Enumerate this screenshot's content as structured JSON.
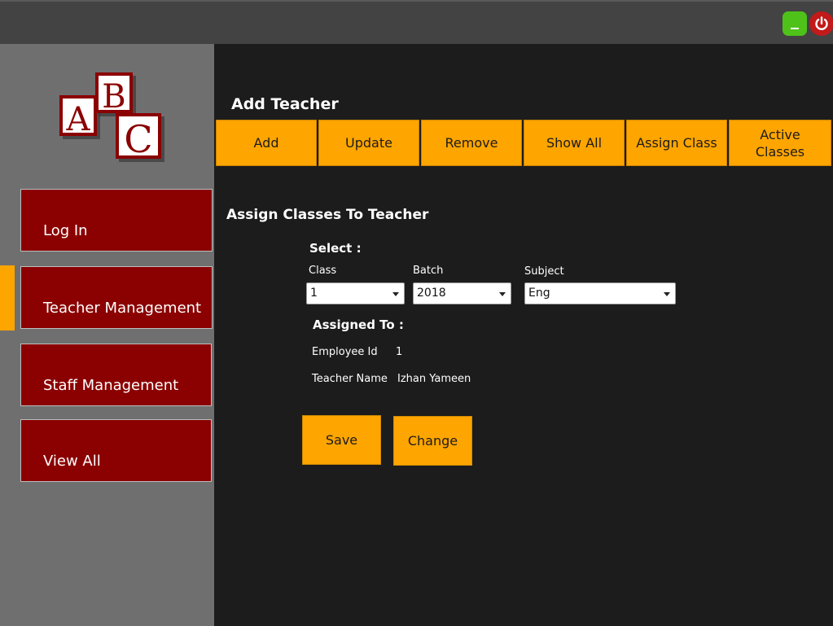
{
  "window": {
    "minimize_icon": "minimize-icon",
    "power_icon": "power-icon",
    "colors": {
      "minimize": "#4fc21a",
      "power": "#c21a1a",
      "titlebar": "#434343"
    }
  },
  "logo": {
    "letters": [
      "A",
      "B",
      "C"
    ]
  },
  "sidebar": {
    "items": [
      {
        "label": "Log In"
      },
      {
        "label": "Teacher Management"
      },
      {
        "label": "Staff Management"
      },
      {
        "label": "View All"
      }
    ],
    "active_index": 1,
    "colors": {
      "item_bg": "#8b0000",
      "marker": "#ffa500",
      "bg": "#6f6f6f"
    }
  },
  "header": {
    "title": "Add Teacher"
  },
  "tabs": [
    {
      "label": "Add"
    },
    {
      "label": "Update"
    },
    {
      "label": "Remove"
    },
    {
      "label": "Show All"
    },
    {
      "label": "Assign Class"
    },
    {
      "label": "Active Classes"
    }
  ],
  "form": {
    "title": "Assign Classes To Teacher",
    "select_heading": "Select :",
    "class": {
      "label": "Class",
      "value": "1"
    },
    "batch": {
      "label": "Batch",
      "value": "2018"
    },
    "subject": {
      "label": "Subject",
      "value": "Eng"
    },
    "assigned_heading": "Assigned To :",
    "employee_id": {
      "label": "Employee Id",
      "value": "1"
    },
    "teacher_name": {
      "label": "Teacher Name",
      "value": "Izhan Yameen"
    }
  },
  "actions": {
    "save": "Save",
    "change": "Change"
  },
  "accent_color": "#ffa500"
}
